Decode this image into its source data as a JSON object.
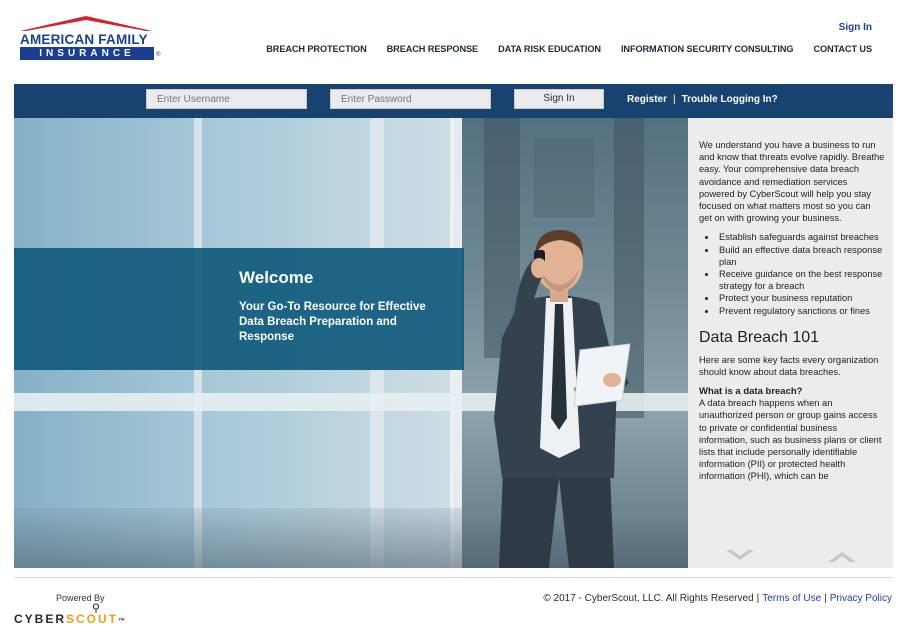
{
  "header": {
    "logo": {
      "line1": "AMERICAN FAMILY",
      "line2": "INSURANCE",
      "reg": "®"
    },
    "signin_link": "Sign In",
    "nav": [
      "BREACH PROTECTION",
      "BREACH RESPONSE",
      "DATA RISK EDUCATION",
      "INFORMATION SECURITY CONSULTING",
      "CONTACT US"
    ]
  },
  "login": {
    "username_placeholder": "Enter Username",
    "password_placeholder": "Enter Password",
    "signin_button": "Sign In",
    "register_link": "Register",
    "separator": "|",
    "trouble_link": "Trouble Logging In?"
  },
  "hero": {
    "title": "Welcome",
    "subtitle": "Your Go-To Resource for Effective Data Breach Preparation and Response"
  },
  "panel": {
    "intro": "We understand you have a business to run and know that threats evolve rapidly. Breathe easy. Your comprehensive data breach avoidance and remediation services powered by CyberScout will help you stay focused on what matters most so you can get on with growing your business.",
    "bullets": [
      "Establish safeguards against breaches",
      "Build an effective data breach response plan",
      "Receive guidance on the best response strategy for a breach",
      "Protect your business reputation",
      "Prevent regulatory sanctions or fines"
    ],
    "heading": "Data Breach 101",
    "heading_para": "Here are some key facts every organization should know about data breaches.",
    "question": "What is a data breach?",
    "answer": "A data breach happens when an unauthorized person or group gains access to private or confidential business information, such as business plans or client lists that include personally identifiable information (PII) or protected health information (PHI), which can be"
  },
  "footer": {
    "powered_by": "Powered By",
    "brand_part1": "CYBER",
    "brand_part2": "SCOUT",
    "brand_tm": "™",
    "copyright": "© 2017 - CyberScout, LLC. All Rights Reserved",
    "sep": "|",
    "terms_link": "Terms of Use",
    "privacy_link": "Privacy Policy"
  },
  "colors": {
    "brand_blue": "#1b3f8f",
    "login_bar": "#18426f",
    "welcome_box": "#105a7d",
    "logo_red": "#d2232a",
    "cyberscout_orange": "#e6a11d"
  }
}
